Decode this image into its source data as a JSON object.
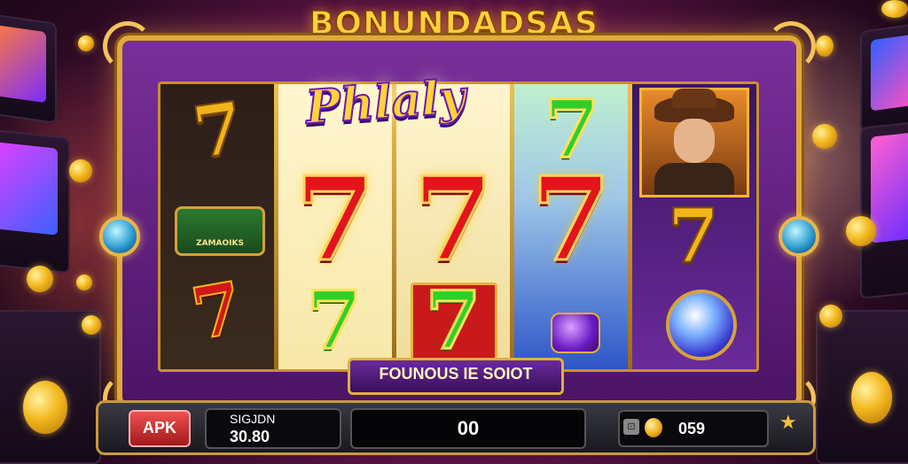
{
  "game": {
    "title": "BONUNDADSAS",
    "logo": "Phlaly",
    "sub_banner": "FOUNOUS IE SOIOT"
  },
  "reels": {
    "symbols": [
      [
        "gold-seven",
        "gem-chest",
        "red-gold-seven"
      ],
      [
        "red-seven",
        "green-seven"
      ],
      [
        "red-seven",
        "green-seven"
      ],
      [
        "green-seven",
        "red-seven",
        "purple-gem"
      ],
      [
        "cowboy",
        "gold-seven",
        "blue-orb"
      ]
    ],
    "chest_label": "ZAMAOIKS",
    "seven": "7"
  },
  "controls": {
    "apk_label": "APK",
    "info_label": "SIGJDN",
    "info_value": "30.80",
    "win_value": "00",
    "coin_tag": "⊡",
    "coin_value": "059",
    "star_icon": "★"
  },
  "colors": {
    "frame_gold": "#e0a93a",
    "machine_purple": "#7a2f9a",
    "red_seven": "#e3141c",
    "green_seven": "#2fcf2a"
  }
}
